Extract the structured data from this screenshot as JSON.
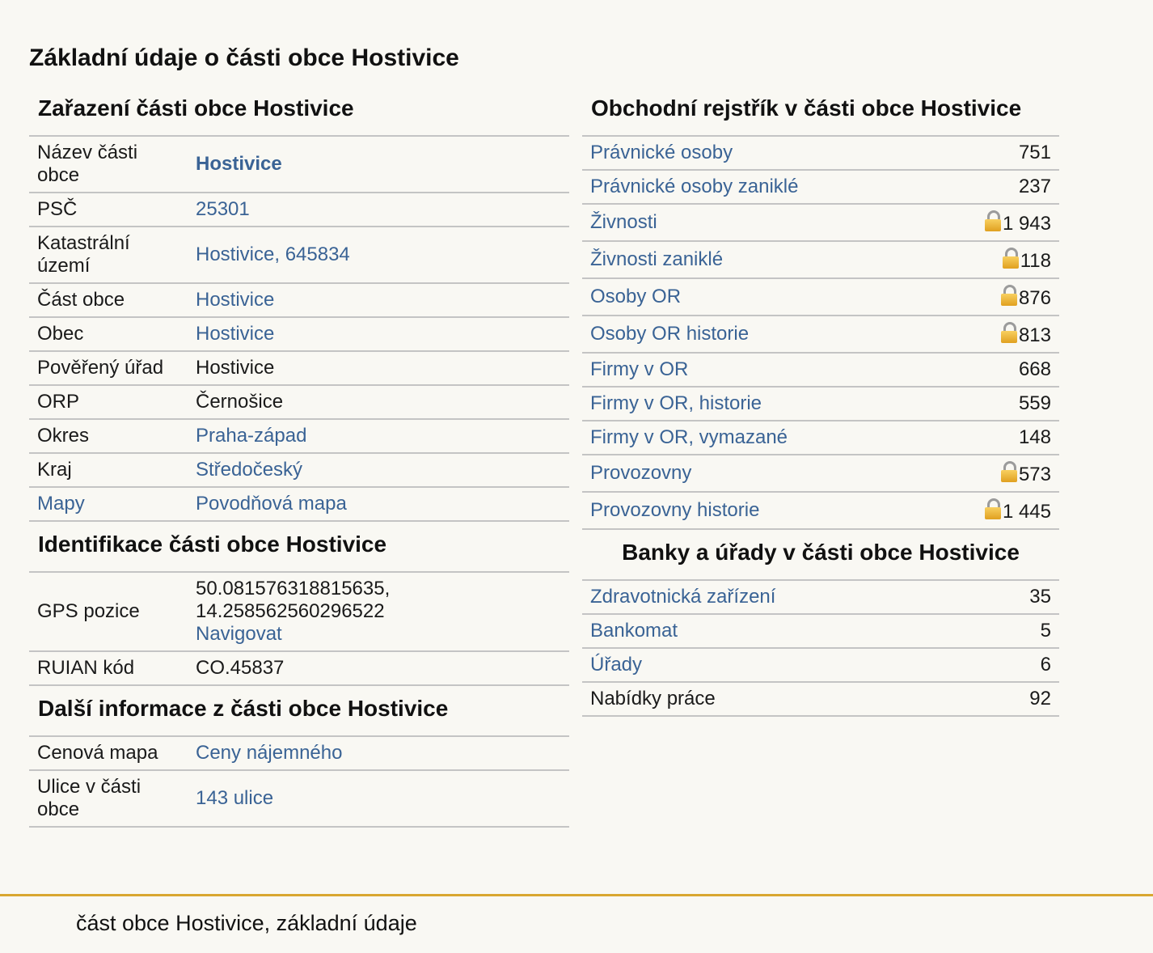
{
  "page_title": "Základní údaje o části obce Hostivice",
  "zarazeni": {
    "title": "Zařazení části obce Hostivice",
    "rows": [
      {
        "label": "Název části obce",
        "value": "Hostivice"
      },
      {
        "label": "PSČ",
        "value": "25301"
      },
      {
        "label": "Katastrální území",
        "value": "Hostivice, 645834"
      },
      {
        "label": "Část obce",
        "value": "Hostivice"
      },
      {
        "label": "Obec",
        "value": "Hostivice"
      },
      {
        "label": "Pověřený úřad",
        "value": "Hostivice"
      },
      {
        "label": "ORP",
        "value": "Černošice"
      },
      {
        "label": "Okres",
        "value": "Praha-západ"
      },
      {
        "label": "Kraj",
        "value": "Středočeský"
      },
      {
        "label": "Mapy",
        "value": "Povodňová mapa"
      }
    ]
  },
  "identifikace": {
    "title": "Identifikace části obce Hostivice",
    "gps_label": "GPS pozice",
    "gps_lat": "50.081576318815635,",
    "gps_lon": "14.258562560296522",
    "gps_link": "Navigovat",
    "ruian_label": "RUIAN kód",
    "ruian_value": "CO.45837"
  },
  "dalsi": {
    "title": "Další informace z části obce Hostivice",
    "rows": [
      {
        "label": "Cenová mapa",
        "value": "Ceny nájemného"
      },
      {
        "label": "Ulice v části obce",
        "value": "143 ulice"
      }
    ]
  },
  "rejstrik": {
    "title": "Obchodní rejstřík v části obce Hostivice",
    "rows": [
      {
        "label": "Právnické osoby",
        "value": "751",
        "locked": false
      },
      {
        "label": "Právnické osoby zaniklé",
        "value": "237",
        "locked": false
      },
      {
        "label": "Živnosti",
        "value": "1 943",
        "locked": true
      },
      {
        "label": "Živnosti zaniklé",
        "value": "118",
        "locked": true
      },
      {
        "label": "Osoby OR",
        "value": "876",
        "locked": true
      },
      {
        "label": "Osoby OR historie",
        "value": "813",
        "locked": true
      },
      {
        "label": "Firmy v OR",
        "value": "668",
        "locked": false
      },
      {
        "label": "Firmy v OR, historie",
        "value": "559",
        "locked": false
      },
      {
        "label": "Firmy v OR, vymazané",
        "value": "148",
        "locked": false
      },
      {
        "label": "Provozovny",
        "value": "573",
        "locked": true
      },
      {
        "label": "Provozovny historie",
        "value": "1 445",
        "locked": true
      }
    ]
  },
  "banky": {
    "title": "Banky a úřady v části obce Hostivice",
    "rows": [
      {
        "label": "Zdravotnická zařízení",
        "value": "35"
      },
      {
        "label": "Bankomat",
        "value": "5"
      },
      {
        "label": "Úřady",
        "value": "6"
      },
      {
        "label": "Nabídky práce",
        "value": "92"
      }
    ]
  },
  "footer": "část obce Hostivice, základní údaje",
  "colors": {
    "link": "#3a6395",
    "rule": "#c4c4c4",
    "footer_line": "#d9a730",
    "background": "#f9f8f3"
  },
  "icons": {
    "locked": "lock-icon"
  }
}
